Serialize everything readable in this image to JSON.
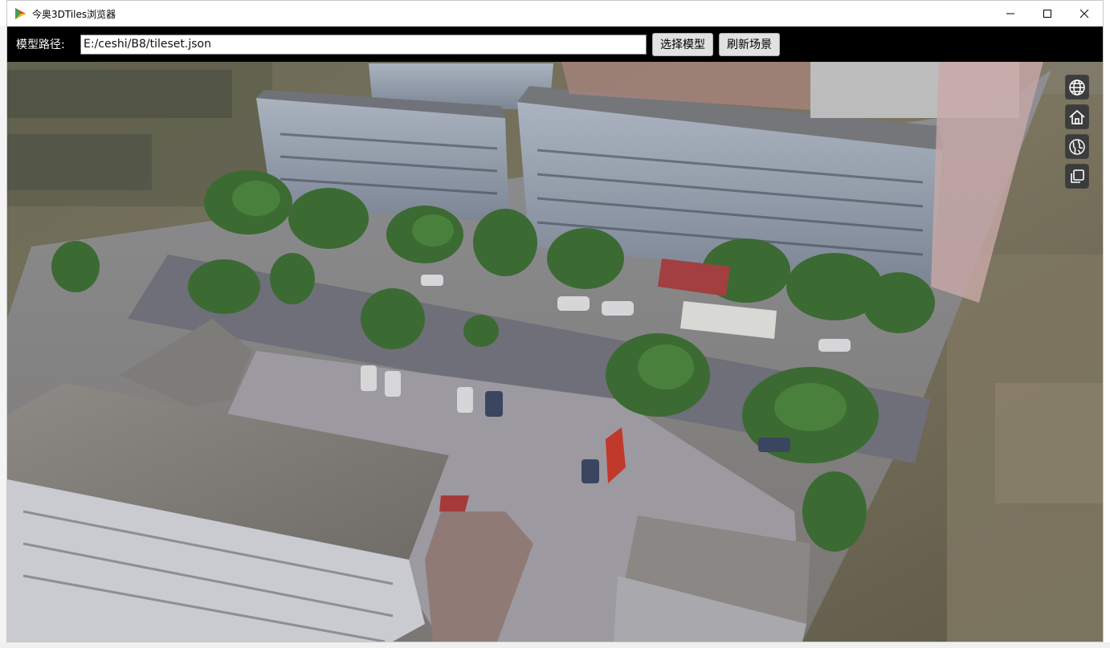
{
  "window": {
    "title": "今奥3DTiles浏览器",
    "controls": {
      "minimize": "minimize-icon",
      "maximize": "maximize-icon",
      "close": "close-icon"
    }
  },
  "toolbar": {
    "path_label": "模型路径:",
    "path_value": "E:/ceshi/B8/tileset.json",
    "select_model_label": "选择模型",
    "refresh_scene_label": "刷新场景"
  },
  "nav_tools": [
    {
      "icon": "globe-icon"
    },
    {
      "icon": "home-icon"
    },
    {
      "icon": "earth-view-icon"
    },
    {
      "icon": "layers-icon"
    }
  ],
  "colors": {
    "toolbar_bg": "#000000",
    "button_bg": "#e1e1e1",
    "nav_btn_bg": "#303336"
  }
}
